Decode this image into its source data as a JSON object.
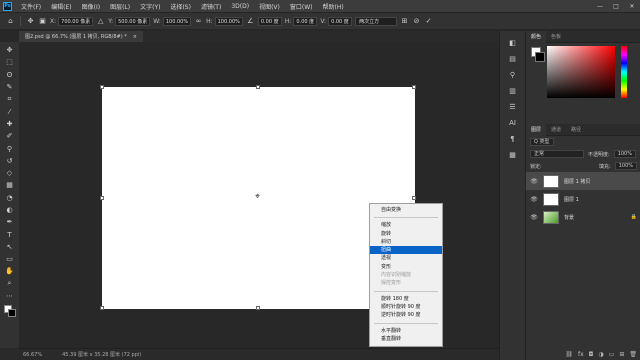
{
  "menubar": {
    "logo": "Ps",
    "items": [
      "文件(F)",
      "编辑(E)",
      "图像(I)",
      "图层(L)",
      "文字(Y)",
      "选择(S)",
      "滤镜(T)",
      "3D(D)",
      "视图(V)",
      "窗口(W)",
      "帮助(H)"
    ],
    "win_buttons": [
      "—",
      "□",
      "✕"
    ]
  },
  "options": {
    "x_label": "X:",
    "x_value": "700.00 像素",
    "y_label": "Y:",
    "y_value": "500.00 像素",
    "w_label": "W:",
    "w_value": "100.00%",
    "h_label": "H:",
    "h_value": "100.00%",
    "angle_value": "0.00 度",
    "hskew_label": "H:",
    "hskew_value": "0.00 度",
    "vskew_label": "V:",
    "vskew_value": "0.00 度",
    "interp_value": "两次立方"
  },
  "doc_tab": {
    "title": "图2.psd @ 66.7% (图层 1 拷贝, RGB/8#) *",
    "close": "×"
  },
  "toolbar_icons": [
    "move-icon",
    "marquee-icon",
    "lasso-icon",
    "quick-select-icon",
    "crop-icon",
    "eyedropper-icon",
    "healing-icon",
    "brush-icon",
    "stamp-icon",
    "history-brush-icon",
    "eraser-icon",
    "gradient-icon",
    "blur-icon",
    "dodge-icon",
    "pen-icon",
    "type-icon",
    "path-select-icon",
    "shape-icon",
    "hand-icon",
    "zoom-icon",
    "more-icon"
  ],
  "toolbar_glyphs": [
    "✥",
    "⬚",
    "ʘ",
    "✎",
    "⌗",
    "⁄",
    "✚",
    "✐",
    "⚲",
    "↺",
    "◇",
    "▦",
    "◔",
    "◐",
    "✒",
    "T",
    "↖",
    "▭",
    "✋",
    "⌕",
    "⋯"
  ],
  "context_menu": {
    "header": "自由变换",
    "group1": [
      "缩放",
      "旋转",
      "斜切",
      "扭曲",
      "透视",
      "变形",
      "内容识别缩放",
      "操控变形"
    ],
    "selected_index": 3,
    "disabled_indices": [
      6,
      7
    ],
    "group2": [
      "旋转 180 度",
      "顺时针旋转 90 度",
      "逆时针旋转 90 度"
    ],
    "group3": [
      "水平翻转",
      "垂直翻转"
    ]
  },
  "status": {
    "zoom": "66.67%",
    "size": "45.39 厘米 x 35.28 厘米 (72 ppi)"
  },
  "color_panel": {
    "tabs": [
      "颜色",
      "色板"
    ]
  },
  "layer_panel": {
    "tabs": [
      "图层",
      "通道",
      "路径"
    ],
    "filter_label": "Q 类型",
    "blend_mode": "正常",
    "opacity_label": "不透明度:",
    "opacity_value": "100%",
    "lock_label": "锁定:",
    "fill_label": "填充:",
    "fill_value": "100%",
    "layers": [
      {
        "name": "图层 1 拷贝",
        "active": true
      },
      {
        "name": "图层 1",
        "active": false
      },
      {
        "name": "背景",
        "active": false,
        "locked": true
      }
    ],
    "footer_icons": [
      "⛓",
      "fx",
      "◘",
      "◑",
      "▭",
      "⊞",
      "🗑"
    ]
  },
  "mini_icons": [
    "◧",
    "▤",
    "⚲",
    "▥",
    "☰",
    "AI",
    "¶",
    "▦"
  ]
}
